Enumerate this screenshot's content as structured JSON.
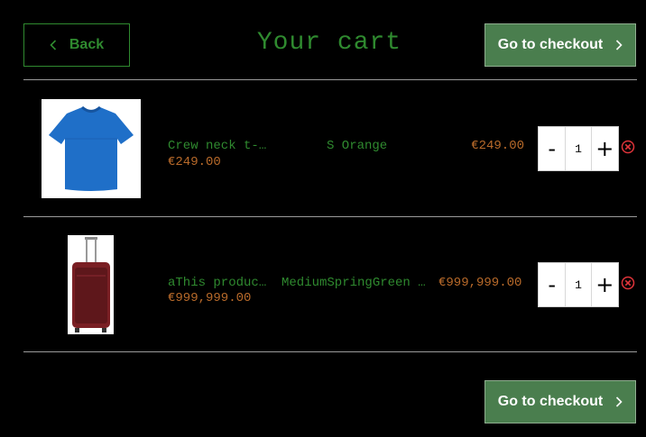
{
  "header": {
    "back_label": "Back",
    "title": "Your cart",
    "checkout_label": "Go to checkout"
  },
  "items": [
    {
      "name": "Crew neck t-…",
      "sub_price": "€249.00",
      "variant": "S Orange",
      "price": "€249.00",
      "quantity": "1",
      "image": "blue-t-shirt"
    },
    {
      "name": "aThis produc…",
      "sub_price": "€999,999.00",
      "variant": "MediumSpringGreen …",
      "price": "€999,999.00",
      "quantity": "1",
      "image": "red-suitcase"
    }
  ],
  "stepper": {
    "minus": "-",
    "plus": "+"
  },
  "footer": {
    "checkout_label": "Go to checkout"
  },
  "colors": {
    "background": "#000000",
    "accent_green": "#2f8a2f",
    "price_orange": "#b86a2a",
    "checkout_bg": "#4a7e4e",
    "remove_red": "#e0343a"
  },
  "icons": {
    "back": "chevron-left-icon",
    "checkout": "chevron-right-icon",
    "remove": "remove-circle-icon"
  }
}
